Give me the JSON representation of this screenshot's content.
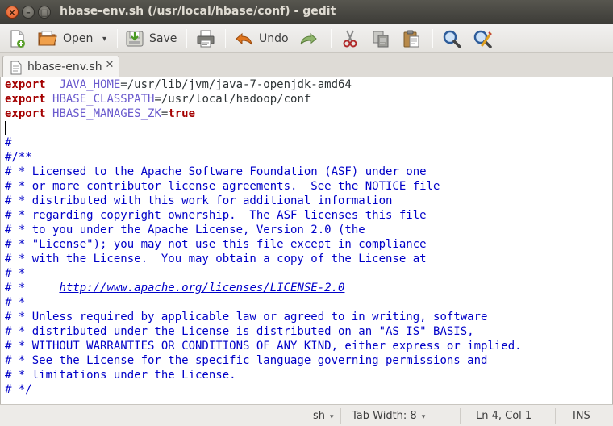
{
  "window": {
    "title": "hbase-env.sh (/usr/local/hbase/conf) - gedit",
    "close_glyph": "×",
    "min_glyph": "–",
    "max_glyph": "□"
  },
  "toolbar": {
    "new_icon": "new-document-icon",
    "open_label": "Open",
    "open_dropdown_glyph": "▾",
    "save_label": "Save",
    "print_icon": "printer-icon",
    "undo_label": "Undo",
    "redo_icon": "redo-icon",
    "cut_icon": "scissors-icon",
    "copy_icon": "copy-icon",
    "paste_icon": "paste-icon",
    "find_icon": "search-icon",
    "replace_icon": "find-replace-icon"
  },
  "tab": {
    "label": "hbase-env.sh",
    "close_glyph": "✕"
  },
  "editor": {
    "lines": [
      {
        "parts": [
          [
            "kw",
            "export"
          ],
          [
            "",
            "  "
          ],
          [
            "var",
            "JAVA_HOME"
          ],
          [
            "",
            "=/usr/lib/jvm/java-7-openjdk-amd64"
          ]
        ]
      },
      {
        "parts": [
          [
            "kw",
            "export"
          ],
          [
            "",
            " "
          ],
          [
            "var",
            "HBASE_CLASSPATH"
          ],
          [
            "",
            "=/usr/local/hadoop/conf"
          ]
        ]
      },
      {
        "parts": [
          [
            "kw",
            "export"
          ],
          [
            "",
            " "
          ],
          [
            "var",
            "HBASE_MANAGES_ZK"
          ],
          [
            "",
            "="
          ],
          [
            "bool",
            "true"
          ]
        ]
      },
      {
        "parts": [
          [
            "caret",
            ""
          ]
        ]
      },
      {
        "parts": [
          [
            "cm",
            "#"
          ]
        ]
      },
      {
        "parts": [
          [
            "cm",
            "#/**"
          ]
        ]
      },
      {
        "parts": [
          [
            "cm",
            "# * Licensed to the Apache Software Foundation (ASF) under one"
          ]
        ]
      },
      {
        "parts": [
          [
            "cm",
            "# * or more contributor license agreements.  See the NOTICE file"
          ]
        ]
      },
      {
        "parts": [
          [
            "cm",
            "# * distributed with this work for additional information"
          ]
        ]
      },
      {
        "parts": [
          [
            "cm",
            "# * regarding copyright ownership.  The ASF licenses this file"
          ]
        ]
      },
      {
        "parts": [
          [
            "cm",
            "# * to you under the Apache License, Version 2.0 (the"
          ]
        ]
      },
      {
        "parts": [
          [
            "cm",
            "# * \"License\"); you may not use this file except in compliance"
          ]
        ]
      },
      {
        "parts": [
          [
            "cm",
            "# * with the License.  You may obtain a copy of the License at"
          ]
        ]
      },
      {
        "parts": [
          [
            "cm",
            "# *"
          ]
        ]
      },
      {
        "parts": [
          [
            "cm",
            "# *     "
          ],
          [
            "url",
            "http://www.apache.org/licenses/LICENSE-2.0"
          ]
        ]
      },
      {
        "parts": [
          [
            "cm",
            "# *"
          ]
        ]
      },
      {
        "parts": [
          [
            "cm",
            "# * Unless required by applicable law or agreed to in writing, software"
          ]
        ]
      },
      {
        "parts": [
          [
            "cm",
            "# * distributed under the License is distributed on an \"AS IS\" BASIS,"
          ]
        ]
      },
      {
        "parts": [
          [
            "cm",
            "# * WITHOUT WARRANTIES OR CONDITIONS OF ANY KIND, either express or implied."
          ]
        ]
      },
      {
        "parts": [
          [
            "cm",
            "# * See the License for the specific language governing permissions and"
          ]
        ]
      },
      {
        "parts": [
          [
            "cm",
            "# * limitations under the License."
          ]
        ]
      },
      {
        "parts": [
          [
            "cm",
            "# */"
          ]
        ]
      }
    ]
  },
  "statusbar": {
    "language": "sh",
    "tab_width": "Tab Width: 8",
    "position": "Ln 4, Col 1",
    "mode": "INS",
    "dropdown_glyph": "▾"
  },
  "colors": {
    "keyword": "#a40000",
    "variable": "#6a5acd",
    "comment": "#0000c8"
  }
}
